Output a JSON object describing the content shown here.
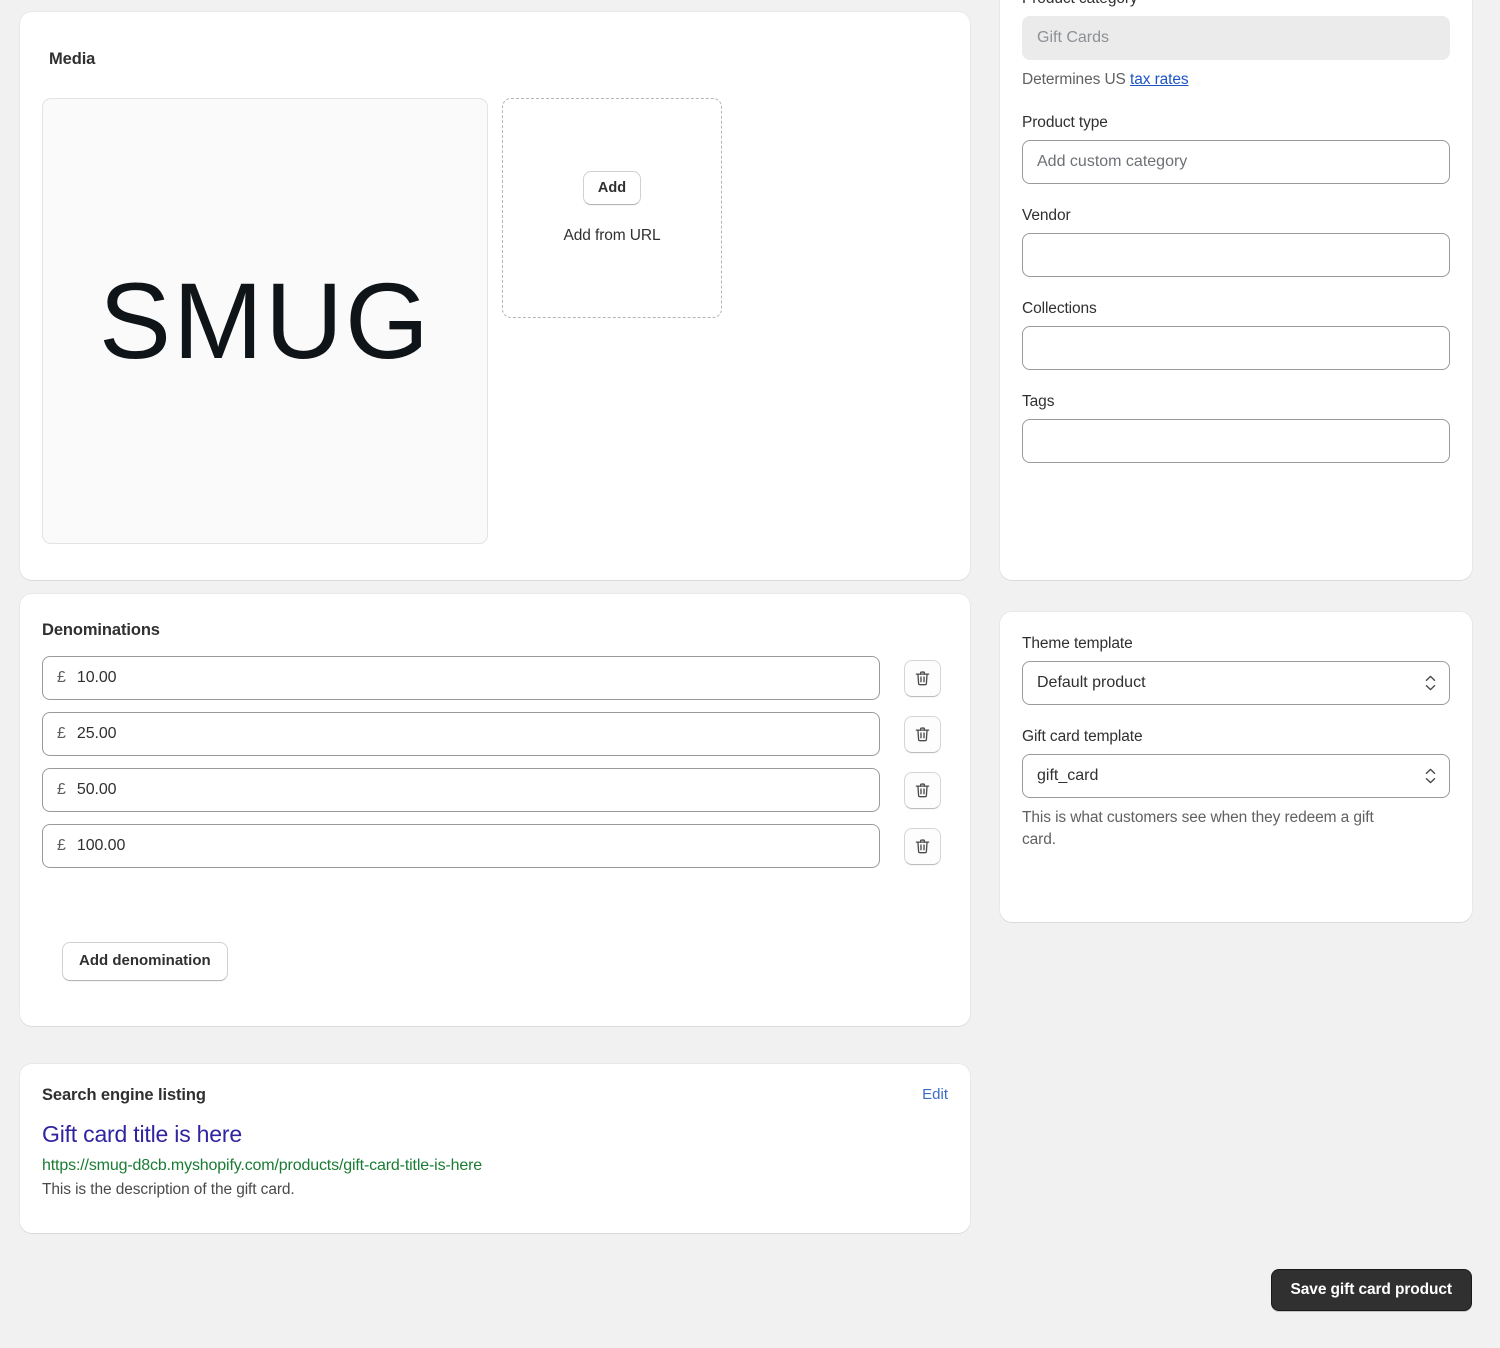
{
  "media": {
    "title": "Media",
    "thumbnail_logo_text": "SMUG",
    "add_button_label": "Add",
    "add_from_url_label": "Add from URL"
  },
  "denominations": {
    "title": "Denominations",
    "items": [
      {
        "currency": "£",
        "amount": "10.00"
      },
      {
        "currency": "£",
        "amount": "25.00"
      },
      {
        "currency": "£",
        "amount": "50.00"
      },
      {
        "currency": "£",
        "amount": "100.00"
      }
    ],
    "add_label": "Add denomination",
    "delete_icon": "trash-icon"
  },
  "seo": {
    "title": "Search engine listing",
    "edit_label": "Edit",
    "preview_title": "Gift card title is here",
    "preview_url": "https://smug-d8cb.myshopify.com/products/gift-card-title-is-here",
    "preview_description": "This is the description of the gift card."
  },
  "organization": {
    "product_category": {
      "label": "Product category",
      "value": "Gift Cards",
      "helper_prefix": "Determines US ",
      "helper_link": "tax rates"
    },
    "product_type": {
      "label": "Product type",
      "placeholder": "Add custom category",
      "value": ""
    },
    "vendor": {
      "label": "Vendor",
      "value": ""
    },
    "collections": {
      "label": "Collections",
      "value": ""
    },
    "tags": {
      "label": "Tags",
      "value": ""
    }
  },
  "theme": {
    "theme_template": {
      "label": "Theme template",
      "value": "Default product"
    },
    "gift_card_template": {
      "label": "Gift card template",
      "value": "gift_card"
    },
    "helper": "This is what customers see when they redeem a gift card."
  },
  "footer": {
    "save_label": "Save gift card product"
  },
  "colors": {
    "page_bg": "#f1f1f1",
    "card_bg": "#ffffff",
    "text": "#303030",
    "link": "#1d54c4",
    "seo_title": "#3024a0",
    "seo_url": "#1a7c33",
    "edit_link": "#3a6ec4",
    "save_bg": "#303030"
  }
}
